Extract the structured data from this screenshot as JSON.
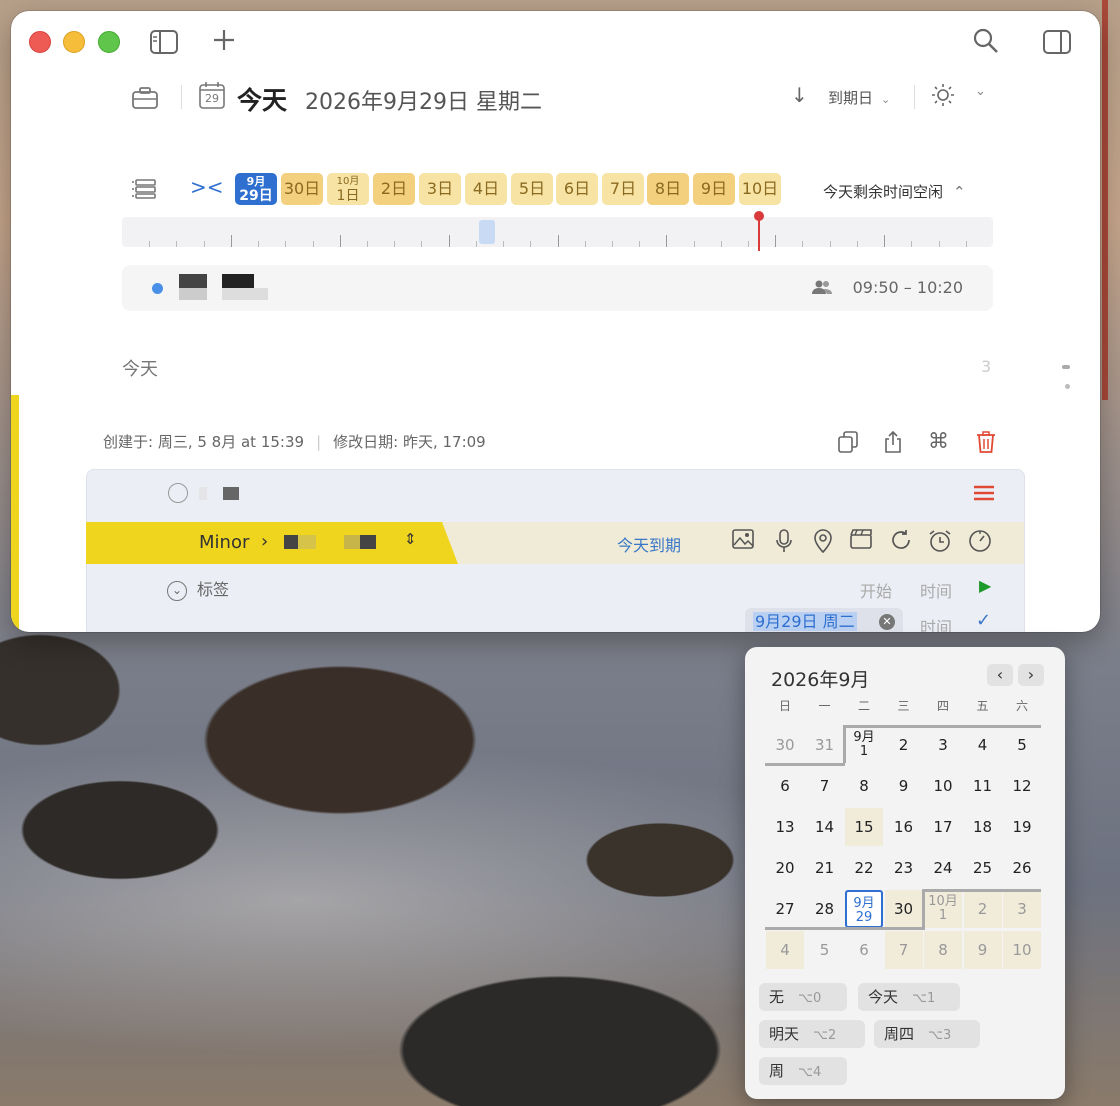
{
  "header": {
    "title": "今天",
    "date": "2026年9月29日 星期二",
    "cal_icon_day": "29",
    "sort_label": "到期日"
  },
  "timeline": {
    "today_chip": {
      "month": "9月",
      "day": "29日"
    },
    "days": [
      {
        "label": "30日"
      },
      {
        "month": "10月",
        "day": "1日"
      },
      {
        "label": "2日"
      },
      {
        "label": "3日"
      },
      {
        "label": "4日"
      },
      {
        "label": "5日"
      },
      {
        "label": "6日"
      },
      {
        "label": "7日"
      },
      {
        "label": "8日"
      },
      {
        "label": "9日"
      },
      {
        "label": "10日"
      }
    ],
    "free_time": "今天剩余时间空闲",
    "progress_fraction": 0.73
  },
  "event": {
    "time": "09:50 – 10:20"
  },
  "section": {
    "label": "今天",
    "count": "3"
  },
  "meta": {
    "created": "创建于:  周三, 5 8月 at 15:39",
    "modified": "修改日期:  昨天, 17:09"
  },
  "detail": {
    "project": "Minor",
    "due": "今天到期",
    "tags_label": "标签",
    "start_label": "开始",
    "time_label": "时间",
    "date_value": "9月29日 周二",
    "time_label2": "时间"
  },
  "calendar": {
    "title": "2026年9月",
    "weekdays": [
      "日",
      "一",
      "二",
      "三",
      "四",
      "五",
      "六"
    ],
    "rows": [
      [
        "30",
        "31",
        "9月\n1",
        "2",
        "3",
        "4",
        "5"
      ],
      [
        "6",
        "7",
        "8",
        "9",
        "10",
        "11",
        "12"
      ],
      [
        "13",
        "14",
        "15",
        "16",
        "17",
        "18",
        "19"
      ],
      [
        "20",
        "21",
        "22",
        "23",
        "24",
        "25",
        "26"
      ],
      [
        "27",
        "28",
        "9月\n29",
        "30",
        "10月\n1",
        "2",
        "3"
      ],
      [
        "4",
        "5",
        "6",
        "7",
        "8",
        "9",
        "10"
      ]
    ],
    "quick": [
      {
        "label": "无",
        "key": "⌥0"
      },
      {
        "label": "今天",
        "key": "⌥1"
      },
      {
        "label": "明天",
        "key": "⌥2"
      },
      {
        "label": "周四",
        "key": "⌥3"
      },
      {
        "label": "周",
        "key": "⌥4"
      }
    ]
  },
  "colors": {
    "accent": "#2e6fd0",
    "project_yellow": "#f0d51e",
    "danger": "#e04a35",
    "go_green": "#1d9a2a"
  }
}
